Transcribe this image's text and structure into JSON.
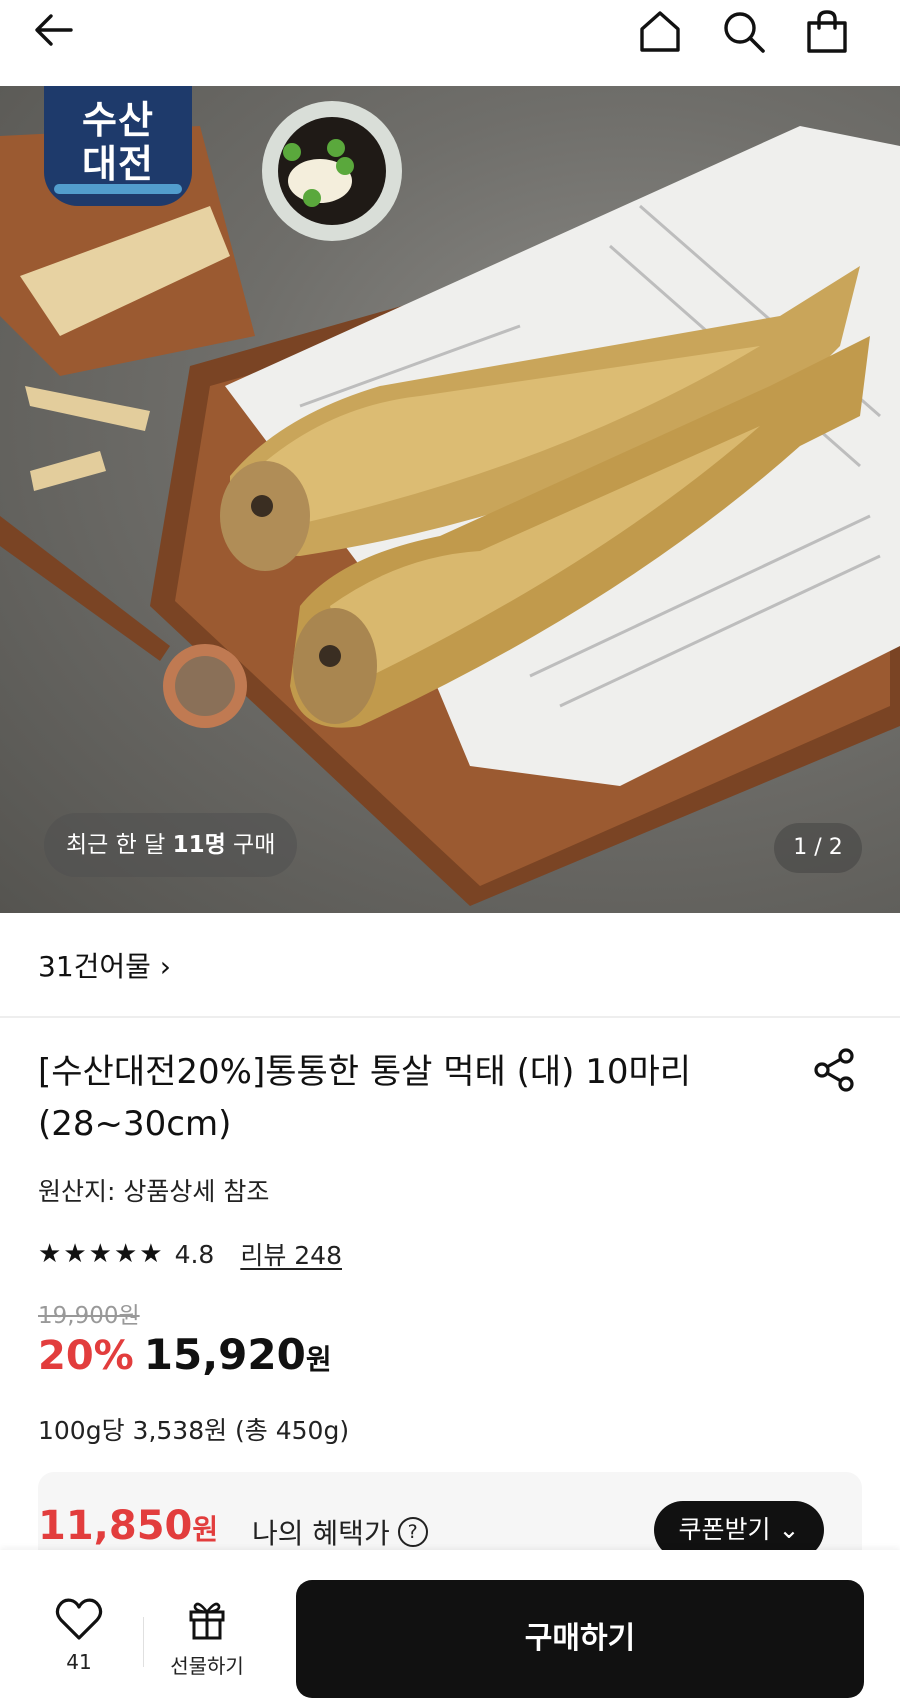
{
  "header": {
    "back_icon": "arrow-left-icon",
    "home_icon": "home-icon",
    "search_icon": "search-icon",
    "cart_icon": "shopping-bag-icon"
  },
  "hero": {
    "badge_line1": "수산",
    "badge_line2": "대전",
    "buyers_prefix": "최근 한 달 ",
    "buyers_count": "11명",
    "buyers_suffix": " 구매",
    "pager": "1 / 2"
  },
  "brand_link": "31건어물 ›",
  "product": {
    "title": "[수산대전20%]통통한 통살 먹태 (대) 10마리 (28~30cm)",
    "origin": "원산지: 상품상세 참조",
    "stars": [
      "★",
      "★",
      "★",
      "★",
      "★"
    ],
    "rating_score": "4.8",
    "review_label": "리뷰 248",
    "original_price": "19,900원",
    "discount_rate": "20%",
    "sale_price": "15,920",
    "currency": "원",
    "unit_price": "100g당 3,538원 (총 450g)"
  },
  "benefit": {
    "price": "11,850",
    "currency": "원",
    "label": "나의 혜택가",
    "help": "?",
    "coupon_button": "쿠폰받기 ⌄"
  },
  "bottom_bar": {
    "wish_count": "41",
    "gift_label": "선물하기",
    "buy_label": "구매하기"
  },
  "colors": {
    "accent_red": "#e23d3d",
    "dark": "#111111",
    "badge_blue": "#1e3a6b"
  }
}
